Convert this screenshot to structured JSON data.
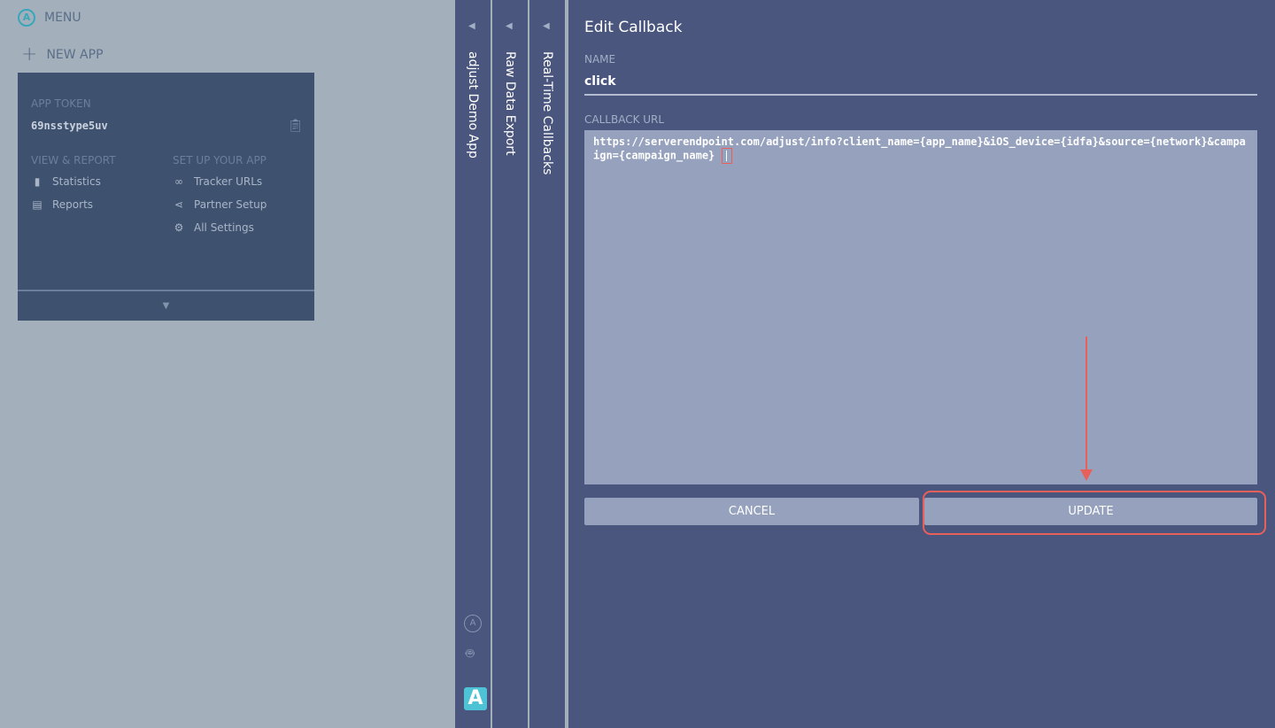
{
  "sidebar": {
    "menu_label": "MENU",
    "new_app_label": "NEW APP",
    "app_card": {
      "token_label": "APP TOKEN",
      "token_value": "69nsstype5uv",
      "view_report_header": "VIEW & REPORT",
      "view_report_items": [
        "Statistics",
        "Reports"
      ],
      "setup_header": "SET UP YOUR APP",
      "setup_items": [
        "Tracker URLs",
        "Partner Setup",
        "All Settings"
      ]
    }
  },
  "panels": [
    "adjust Demo App",
    "Raw Data Export",
    "Real-Time Callbacks"
  ],
  "editor": {
    "title": "Edit Callback",
    "name_label": "NAME",
    "name_value": "click",
    "url_label": "CALLBACK URL",
    "url_value": "https://serverendpoint.com/adjust/info?client_name={app_name}&iOS_device={idfa}&source={network}&campaign={campaign_name}",
    "cancel_label": "CANCEL",
    "update_label": "UPDATE"
  },
  "colors": {
    "annotation": "#e8605a",
    "panel": "#4a567d",
    "card": "#3e5270"
  }
}
